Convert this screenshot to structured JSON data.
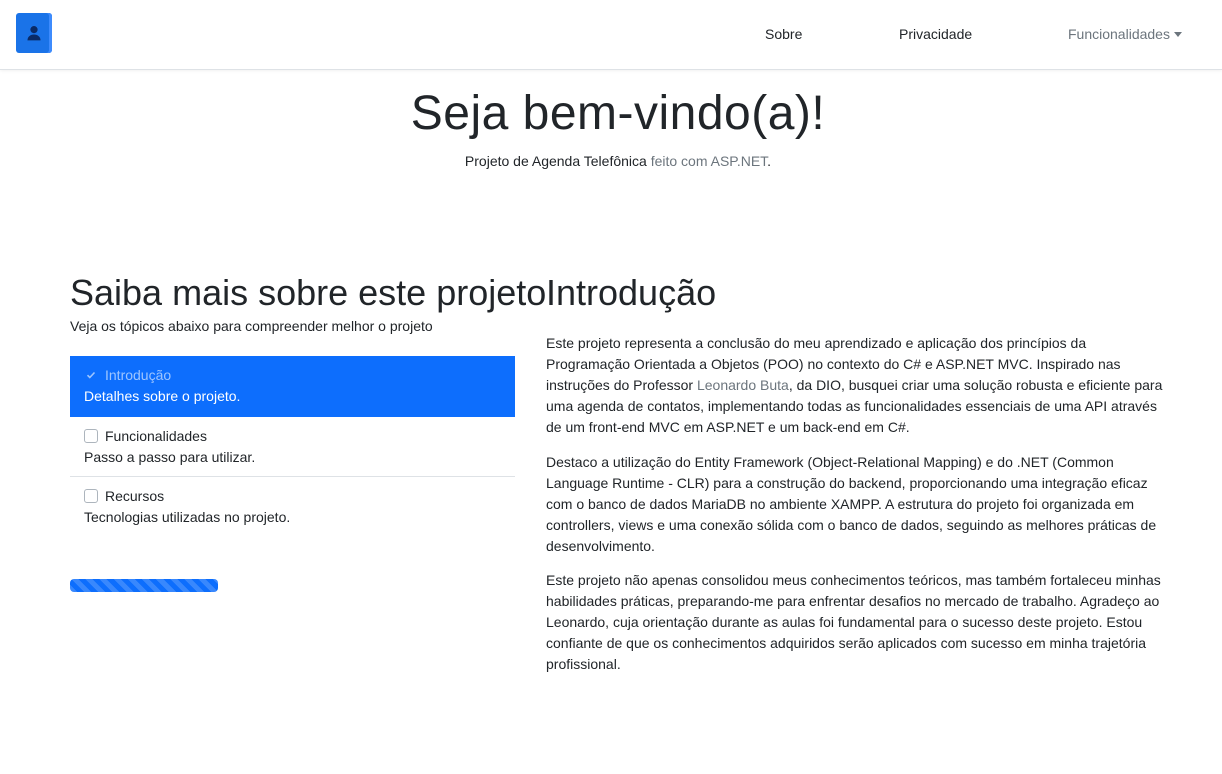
{
  "navbar": {
    "brand_icon": "user-icon",
    "links": {
      "sobre": "Sobre",
      "privacidade": "Privacidade",
      "funcionalidades": "Funcionalidades"
    }
  },
  "hero": {
    "title": "Seja bem-vindo(a)!",
    "subtitle_main": "Projeto de Agenda Telefônica",
    "subtitle_muted": "feito com ASP.NET",
    "subtitle_end": "."
  },
  "left": {
    "title": "Saiba mais sobre este projeto",
    "subtitle": "Veja os tópicos abaixo para compreender melhor o projeto",
    "items": [
      {
        "label": "Introdução",
        "desc": "Detalhes sobre o projeto.",
        "active": true
      },
      {
        "label": "Funcionalidades",
        "desc": "Passo a passo para utilizar.",
        "active": false
      },
      {
        "label": "Recursos",
        "desc": "Tecnologias utilizadas no projeto.",
        "active": false
      }
    ],
    "progress": 1.0
  },
  "right": {
    "title": "Introdução",
    "p1_a": "Este projeto representa a conclusão do meu aprendizado e aplicação dos princípios da Programação Orientada a Objetos (POO) no contexto do C# e ASP.NET MVC. Inspirado nas instruções do Professor ",
    "p1_link": "Leonardo Buta",
    "p1_b": ", da DIO, busquei criar uma solução robusta e eficiente para uma agenda de contatos, implementando todas as funcionalidades essenciais de uma API através de um front-end MVC em ASP.NET e um back-end em C#.",
    "p2": "Destaco a utilização do Entity Framework (Object-Relational Mapping) e do .NET (Common Language Runtime - CLR) para a construção do backend, proporcionando uma integração eficaz com o banco de dados MariaDB no ambiente XAMPP. A estrutura do projeto foi organizada em controllers, views e uma conexão sólida com o banco de dados, seguindo as melhores práticas de desenvolvimento.",
    "p3": "Este projeto não apenas consolidou meus conhecimentos teóricos, mas também fortaleceu minhas habilidades práticas, preparando-me para enfrentar desafios no mercado de trabalho. Agradeço ao Leonardo, cuja orientação durante as aulas foi fundamental para o sucesso deste projeto. Estou confiante de que os conhecimentos adquiridos serão aplicados com sucesso em minha trajetória profissional."
  },
  "colors": {
    "primary": "#0d6efd",
    "muted": "#6c757d",
    "text": "#212529"
  }
}
